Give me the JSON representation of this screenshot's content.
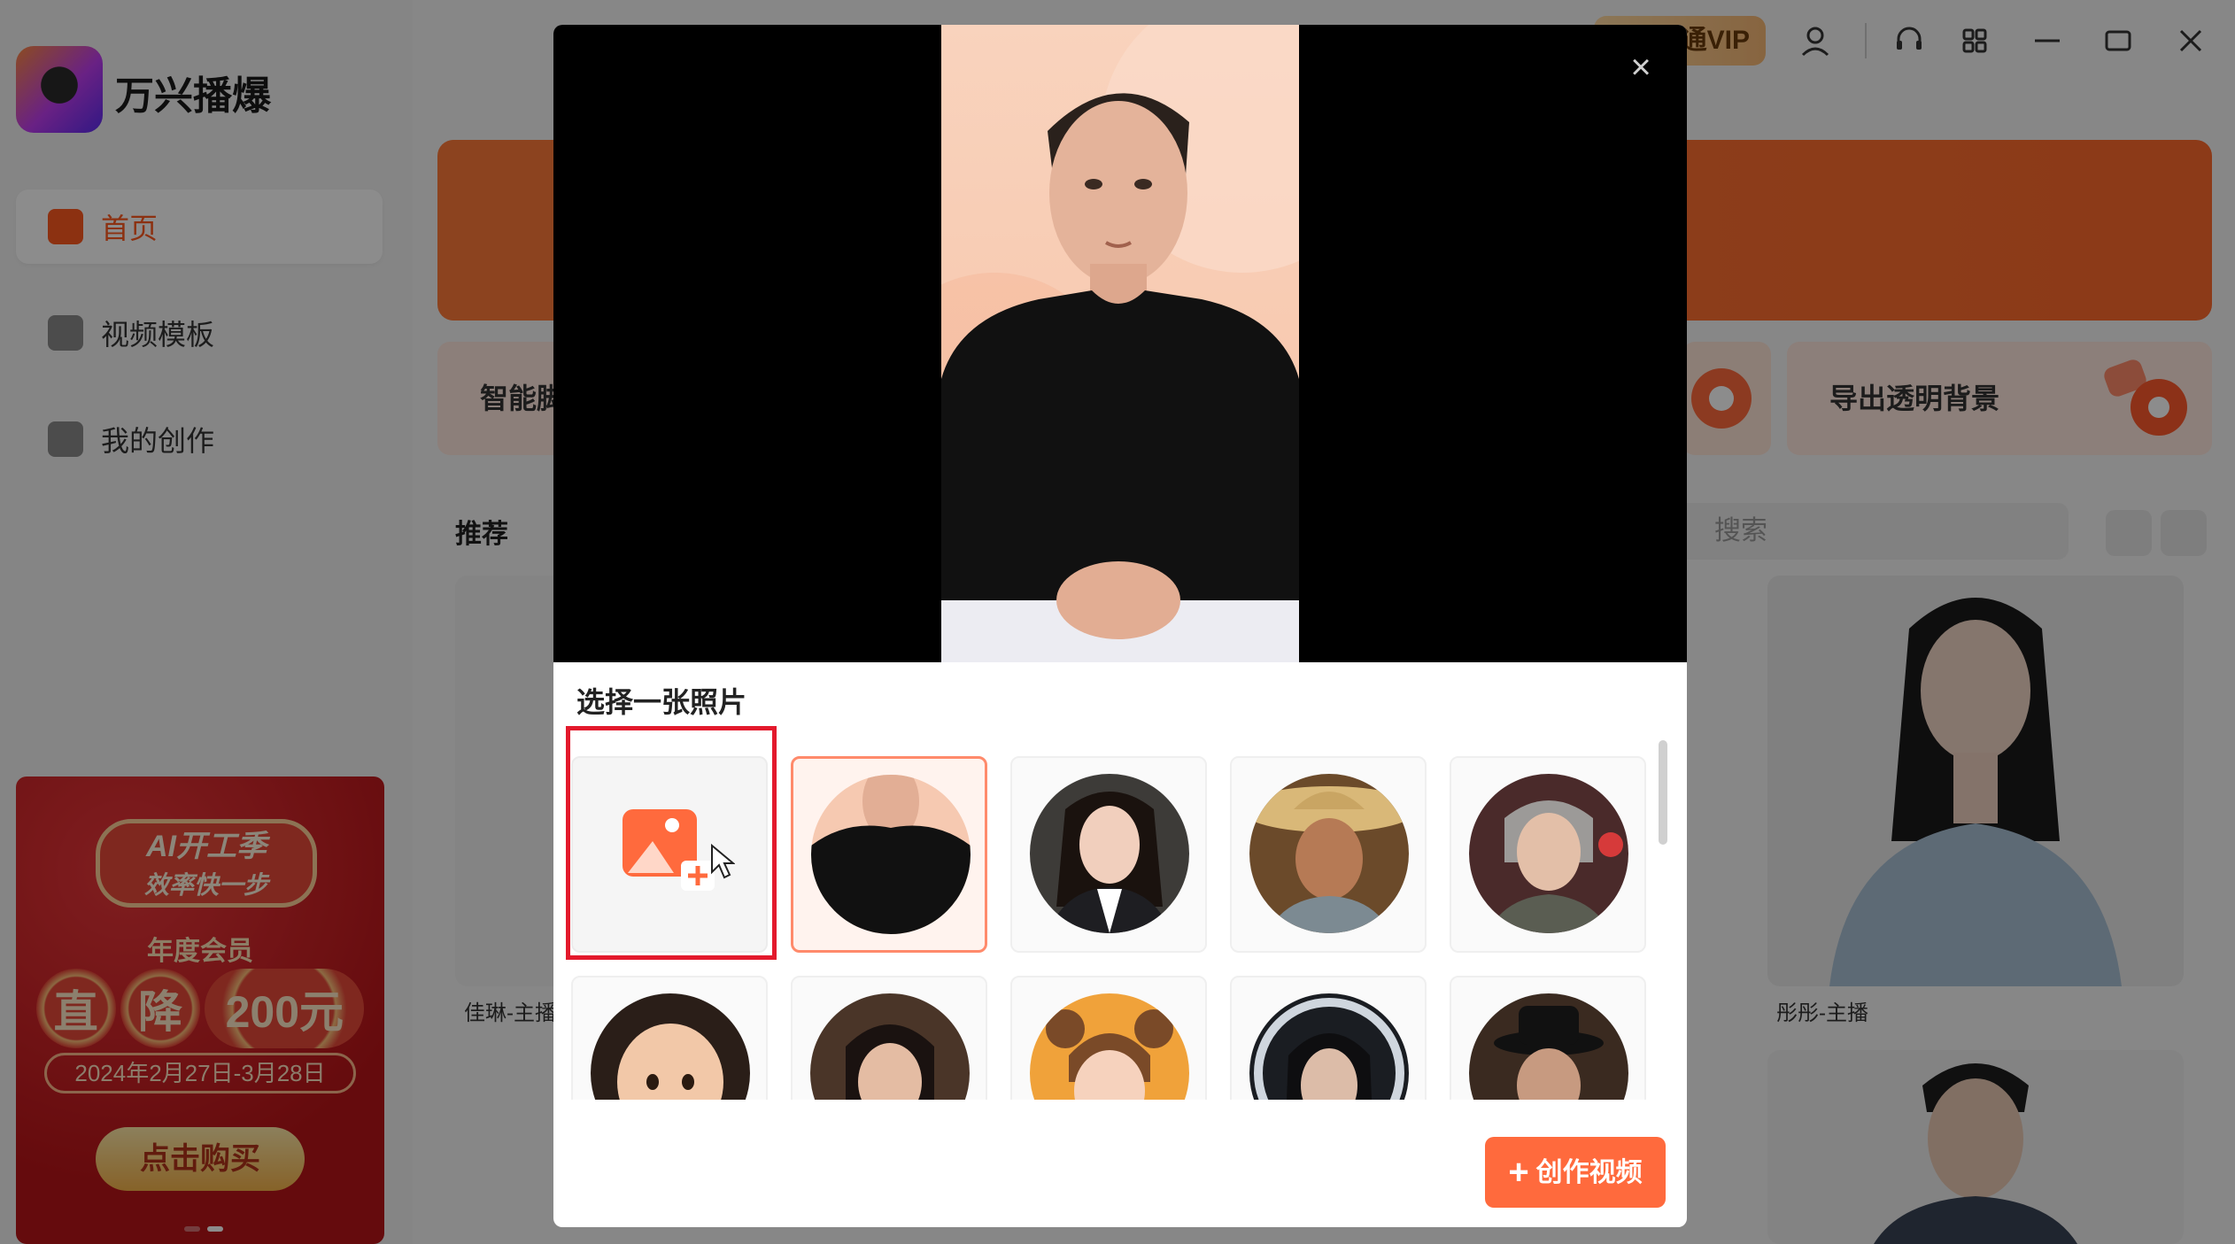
{
  "app": {
    "name": "万兴播爆"
  },
  "sidebar": {
    "items": [
      {
        "label": "首页",
        "icon": "home-icon",
        "active": true
      },
      {
        "label": "视频模板",
        "icon": "template-icon",
        "active": false
      },
      {
        "label": "我的创作",
        "icon": "creation-icon",
        "active": false
      }
    ]
  },
  "promo": {
    "badge_line1": "AI开工季",
    "badge_line2": "效率快一步",
    "subtitle": "年度会员",
    "price_chars": [
      "直",
      "降",
      "200元"
    ],
    "date_range": "2024年2月27日-3月28日",
    "button_label": "点击购买"
  },
  "topbar": {
    "vip_label": "通VIP"
  },
  "main": {
    "features": [
      "智能脚",
      "导出透明背景"
    ],
    "section_title": "推荐",
    "search_placeholder": "搜索",
    "cards": [
      {
        "label": "佳琳-主播"
      },
      {
        "label": "彤彤-主播"
      }
    ]
  },
  "modal": {
    "close_symbol": "×",
    "select_title": "选择一张照片",
    "create_button_plus": "+",
    "create_button_label": "创作视频",
    "photos": [
      {
        "name": "photo-young-man",
        "selected": true
      },
      {
        "name": "photo-young-woman",
        "selected": false
      },
      {
        "name": "photo-man-straw-hat",
        "selected": false
      },
      {
        "name": "photo-elderly-woman",
        "selected": false
      },
      {
        "name": "photo-baby",
        "selected": false
      },
      {
        "name": "photo-middle-aged-woman",
        "selected": false
      },
      {
        "name": "photo-little-girl",
        "selected": false
      },
      {
        "name": "photo-woman-dark",
        "selected": false
      },
      {
        "name": "photo-elderly-man-hat",
        "selected": false
      }
    ]
  },
  "colors": {
    "accent": "#ff6a3d",
    "highlight_box": "#e3192c",
    "promo_red": "#c81a1e"
  }
}
